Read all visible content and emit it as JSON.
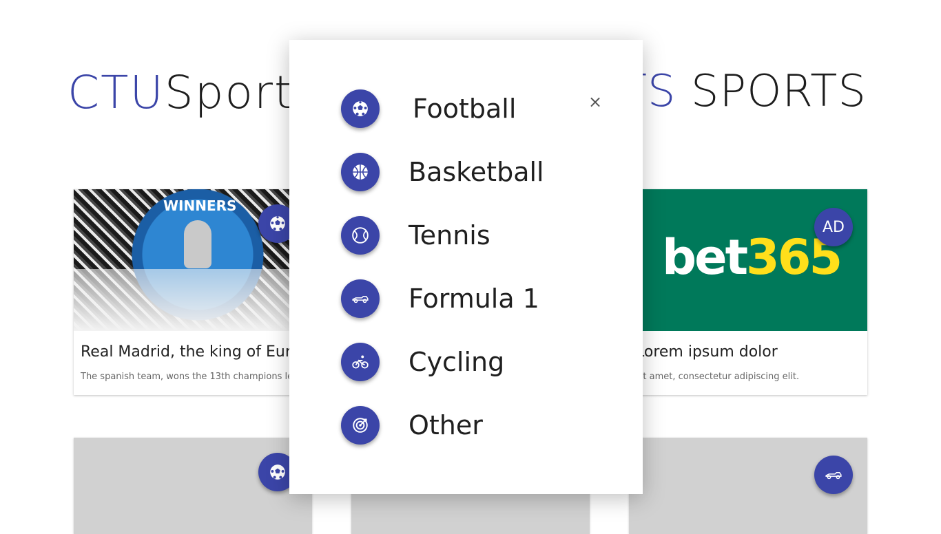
{
  "header": {
    "left_logo_accent": "CTU",
    "left_logo_rest": "Sports",
    "right_logo_accent": "ATS",
    "right_logo_rest": "SPORTS"
  },
  "cards": [
    {
      "title": "Real Madrid, the king of Europe",
      "description": "The spanish team, wons the 13th champions league",
      "image_text": "WINNERS",
      "badge_icon": "football-icon"
    },
    {
      "title": "Lorem ipsum dolor",
      "description": "sit amet, consectetur adipiscing elit.",
      "ad_brand_white": "bet",
      "ad_brand_yellow": "365",
      "badge_label": "AD",
      "colors": {
        "ad_background": "#00795a",
        "ad_yellow": "#ffdf1b"
      }
    }
  ],
  "lower_cards": [
    {
      "badge_icon": "football-icon"
    },
    {
      "badge_icon": "formula1-icon"
    }
  ],
  "menu": {
    "close_label": "×",
    "items": [
      {
        "label": "Football",
        "icon": "football-icon"
      },
      {
        "label": "Basketball",
        "icon": "basketball-icon"
      },
      {
        "label": "Tennis",
        "icon": "tennis-ball-icon"
      },
      {
        "label": "Formula 1",
        "icon": "formula1-car-icon"
      },
      {
        "label": "Cycling",
        "icon": "bicycle-icon"
      },
      {
        "label": "Other",
        "icon": "target-icon"
      }
    ]
  },
  "colors": {
    "accent": "#3b45a8",
    "gray_card": "#d1d1d1"
  }
}
